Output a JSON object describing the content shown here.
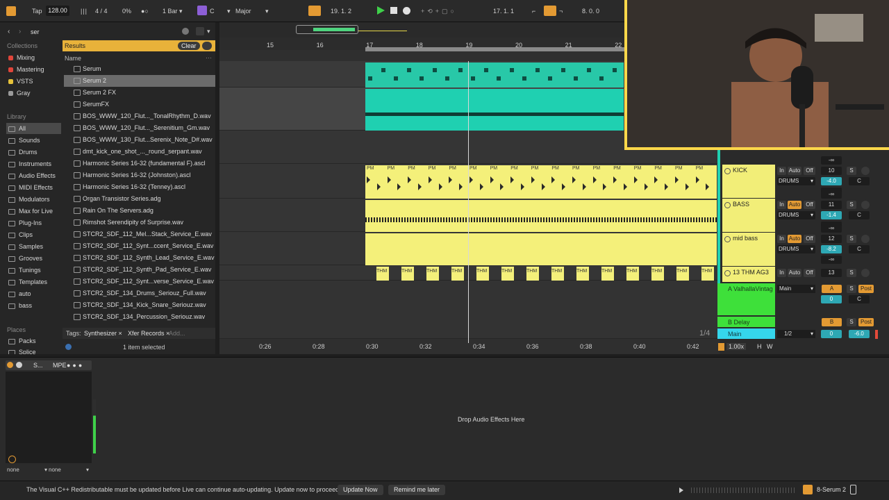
{
  "transport": {
    "tap_label": "Tap",
    "tempo": "128.00",
    "time_signature": "4 / 4",
    "groove": "0%",
    "quantize": "1 Bar",
    "key": "C",
    "scale": "Major",
    "position": "19.  1.  2",
    "loop_start": "17.  1.  1",
    "loop_length": "8.  0.  0"
  },
  "browser": {
    "search_value": "ser",
    "results_label": "Results",
    "clear_label": "Clear",
    "name_header": "Name",
    "collections_title": "Collections",
    "collections": [
      {
        "label": "Mixing",
        "color": "#e0453a"
      },
      {
        "label": "Mastering",
        "color": "#e0453a"
      },
      {
        "label": "VSTS",
        "color": "#e6c23a"
      },
      {
        "label": "Gray",
        "color": "#9a9a9a"
      }
    ],
    "library_title": "Library",
    "library": [
      "All",
      "Sounds",
      "Drums",
      "Instruments",
      "Audio Effects",
      "MIDI Effects",
      "Modulators",
      "Max for Live",
      "Plug-Ins",
      "Clips",
      "Samples",
      "Grooves",
      "Tunings",
      "Templates",
      "auto",
      "bass"
    ],
    "places_title": "Places",
    "places": [
      "Packs",
      "Splice"
    ],
    "results": [
      "Serum",
      "Serum 2",
      "Serum 2 FX",
      "SerumFX",
      "BOS_WWW_120_Flut..._TonalRhythm_D.wav",
      "BOS_WWW_120_Flut..._Serenitium_Gm.wav",
      "BOS_WWW_130_Flut...Serenix_Note_D#.wav",
      "dmt_kick_one_shot_..._round_serpant.wav",
      "Harmonic Series 16-32 (fundamental F).ascl",
      "Harmonic Series 16-32 (Johnston).ascl",
      "Harmonic Series 16-32 (Tenney).ascl",
      "Organ Transistor Series.adg",
      "Rain On The Servers.adg",
      "Rimshot Serendipity of Surprise.wav",
      "STCR2_SDF_112_Mel...Stack_Service_E.wav",
      "STCR2_SDF_112_Synt...ccent_Service_E.wav",
      "STCR2_SDF_112_Synth_Lead_Service_E.wav",
      "STCR2_SDF_112_Synth_Pad_Service_E.wav",
      "STCR2_SDF_112_Synt...verse_Service_E.wav",
      "STCR2_SDF_134_Drums_Seriouz_Full.wav",
      "STCR2_SDF_134_Kick_Snare_Seriouz.wav",
      "STCR2_SDF_134_Percussion_Seriouz.wav"
    ],
    "tags_label": "Tags:",
    "tags": [
      "Synthesizer",
      "Xfer Records"
    ],
    "add_tag": "Add...",
    "selection_status": "1 item selected"
  },
  "arrangement": {
    "bars": [
      "15",
      "16",
      "17",
      "18",
      "19",
      "20",
      "21",
      "22"
    ],
    "times": [
      "0:26",
      "0:28",
      "0:30",
      "0:32",
      "0:34",
      "0:36",
      "0:38",
      "0:40",
      "0:42"
    ],
    "grid_label": "1/4",
    "clip_label_pm": "PM",
    "clip_label_thm": "THM"
  },
  "mixer": {
    "tracks": [
      {
        "name": "KICK",
        "number": "10",
        "route": "DRUMS",
        "volume": "-4.0",
        "pan": "C"
      },
      {
        "name": "BASS",
        "number": "11",
        "route": "DRUMS",
        "volume": "-1.4",
        "pan": "C"
      },
      {
        "name": "mid bass",
        "number": "12",
        "route": "DRUMS",
        "volume": "-8.2",
        "pan": "C"
      },
      {
        "name": "13 THM  AG3",
        "number": "13",
        "route": "",
        "volume": "",
        "pan": ""
      }
    ],
    "in_label": "In",
    "auto_label": "Auto",
    "off_label": "Off",
    "solo_label": "S",
    "inf_label": "-∞",
    "return_a": {
      "name": "A ValhallaVintag",
      "route": "Main",
      "letter": "A",
      "post": "Post",
      "send": "0",
      "pan": "C"
    },
    "return_b": {
      "name": "B Delay",
      "letter": "B",
      "post": "Post"
    },
    "main": {
      "name": "Main",
      "ratio": "1/2",
      "send": "0",
      "volume": "-6.0"
    },
    "zoom": "1.00x",
    "h_label": "H",
    "w_label": "W"
  },
  "device": {
    "title": "S...",
    "mpe_label": "MPE",
    "drop_text": "Drop Audio Effects Here",
    "select_a": "none",
    "select_b": "none"
  },
  "status": {
    "message": "The Visual C++ Redistributable must be updated before Live can continue auto-updating. Update now to proceed.",
    "update_now": "Update Now",
    "remind_later": "Remind me later",
    "track_name": "8-Serum 2"
  },
  "colors": {
    "accent": "#e39a33",
    "cyan_clip": "#1fd0b1",
    "yellow_clip": "#f4f07a",
    "selection": "#7a7a7a",
    "main_track": "#35d6ec",
    "return_green": "#3ee03a"
  }
}
